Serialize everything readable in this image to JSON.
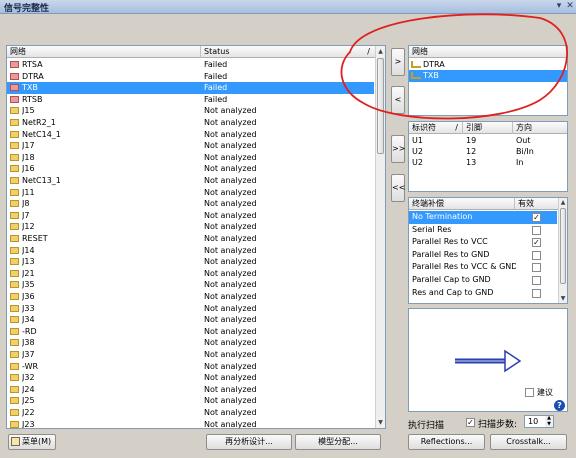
{
  "window": {
    "title": "信号完整性",
    "pin_icon": "pin-icon",
    "close_icon": "close-icon"
  },
  "net_list": {
    "col_net": "网络",
    "col_status": "Status",
    "sort_glyph": "/",
    "rows": [
      {
        "name": "RTSA",
        "status": "Failed",
        "color": "red"
      },
      {
        "name": "DTRA",
        "status": "Failed",
        "color": "red"
      },
      {
        "name": "TXB",
        "status": "Failed",
        "color": "red",
        "selected": true
      },
      {
        "name": "RTSB",
        "status": "Failed",
        "color": "red"
      },
      {
        "name": "J15",
        "status": "Not analyzed",
        "color": "yellow"
      },
      {
        "name": "NetR2_1",
        "status": "Not analyzed",
        "color": "yellow"
      },
      {
        "name": "NetC14_1",
        "status": "Not analyzed",
        "color": "yellow"
      },
      {
        "name": "J17",
        "status": "Not analyzed",
        "color": "yellow"
      },
      {
        "name": "J18",
        "status": "Not analyzed",
        "color": "yellow"
      },
      {
        "name": "J16",
        "status": "Not analyzed",
        "color": "yellow"
      },
      {
        "name": "NetC13_1",
        "status": "Not analyzed",
        "color": "yellow"
      },
      {
        "name": "J11",
        "status": "Not analyzed",
        "color": "yellow"
      },
      {
        "name": "J8",
        "status": "Not analyzed",
        "color": "yellow"
      },
      {
        "name": "J7",
        "status": "Not analyzed",
        "color": "yellow"
      },
      {
        "name": "J12",
        "status": "Not analyzed",
        "color": "yellow"
      },
      {
        "name": "RESET",
        "status": "Not analyzed",
        "color": "yellow"
      },
      {
        "name": "J14",
        "status": "Not analyzed",
        "color": "yellow"
      },
      {
        "name": "J13",
        "status": "Not analyzed",
        "color": "yellow"
      },
      {
        "name": "J21",
        "status": "Not analyzed",
        "color": "yellow"
      },
      {
        "name": "J35",
        "status": "Not analyzed",
        "color": "yellow"
      },
      {
        "name": "J36",
        "status": "Not analyzed",
        "color": "yellow"
      },
      {
        "name": "J33",
        "status": "Not analyzed",
        "color": "yellow"
      },
      {
        "name": "J34",
        "status": "Not analyzed",
        "color": "yellow"
      },
      {
        "name": "-RD",
        "status": "Not analyzed",
        "color": "yellow"
      },
      {
        "name": "J38",
        "status": "Not analyzed",
        "color": "yellow"
      },
      {
        "name": "J37",
        "status": "Not analyzed",
        "color": "yellow"
      },
      {
        "name": "-WR",
        "status": "Not analyzed",
        "color": "yellow"
      },
      {
        "name": "J32",
        "status": "Not analyzed",
        "color": "yellow"
      },
      {
        "name": "J24",
        "status": "Not analyzed",
        "color": "yellow"
      },
      {
        "name": "J25",
        "status": "Not analyzed",
        "color": "yellow"
      },
      {
        "name": "J22",
        "status": "Not analyzed",
        "color": "yellow"
      },
      {
        "name": "J23",
        "status": "Not analyzed",
        "color": "yellow"
      }
    ]
  },
  "transfer_buttons": {
    "add": ">",
    "remove": "<",
    "add_all": ">>",
    "remove_all": "<<"
  },
  "selected_nets": {
    "header": "网络",
    "rows": [
      {
        "name": "DTRA",
        "selected": false
      },
      {
        "name": "TXB",
        "selected": true
      }
    ]
  },
  "pins": {
    "col_designator": "标识符",
    "col_pin": "引脚",
    "col_direction": "方向",
    "sort_glyph": "/",
    "rows": [
      {
        "designator": "U1",
        "pin": "19",
        "direction": "Out"
      },
      {
        "designator": "U2",
        "pin": "12",
        "direction": "Bi/In"
      },
      {
        "designator": "U2",
        "pin": "13",
        "direction": "In"
      }
    ]
  },
  "termination": {
    "col_name": "终端补偿",
    "col_enabled": "有效",
    "rows": [
      {
        "name": "No Termination",
        "checked": true,
        "selected": true
      },
      {
        "name": "Serial Res",
        "checked": false
      },
      {
        "name": "Parallel Res to VCC",
        "checked": true
      },
      {
        "name": "Parallel Res to GND",
        "checked": false
      },
      {
        "name": "Parallel Res to VCC & GND",
        "checked": false
      },
      {
        "name": "Parallel Cap to GND",
        "checked": false
      },
      {
        "name": "Res and Cap to GND",
        "checked": false
      }
    ]
  },
  "preview": {
    "suggest_label": "建议",
    "suggest_checked": false,
    "help_icon": "help-icon"
  },
  "scan": {
    "run_label": "执行扫描",
    "steps_label": "扫描步数:",
    "steps_checked": true,
    "steps_value": "10"
  },
  "footer": {
    "menu_label": "菜单(M)",
    "reanalyze_label": "再分析设计...",
    "model_assign_label": "模型分配...",
    "reflections_label": "Reflections...",
    "crosstalk_label": "Crosstalk..."
  },
  "colors": {
    "selection": "#3399ff",
    "failed": "#e89a9a",
    "not_analyzed": "#f1d06a",
    "annotation": "#e02020"
  }
}
